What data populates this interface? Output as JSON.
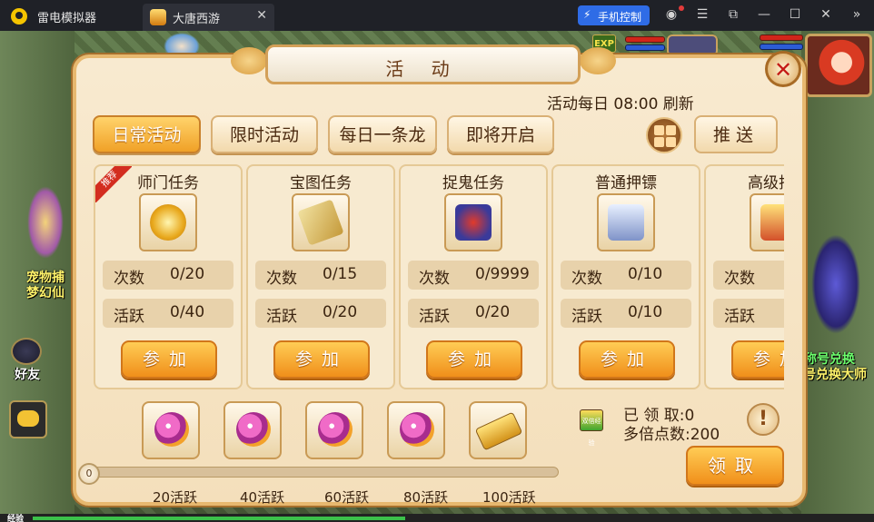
{
  "app": {
    "name": "雷电模拟器",
    "tab_title": "大唐西游",
    "tab_close": "✕",
    "phone_control": "手机控制",
    "window_buttons": {
      "account": "◉",
      "menu": "☰",
      "restore": "⧉",
      "minimize": "—",
      "maximize": "☐",
      "close": "✕",
      "more": "»"
    }
  },
  "hud": {
    "exp_badge": "EXP",
    "left_labels": [
      "宠物捕",
      "梦幻仙"
    ],
    "friend": "好友",
    "right_labels": [
      "称号兑换",
      "称号兑换大师"
    ],
    "exp_bar_label": "经验"
  },
  "dialog": {
    "title": "活 动",
    "close": "✕",
    "refresh_text": "活动每日 08:00 刷新",
    "tabs": [
      {
        "label": "日常活动",
        "active": true
      },
      {
        "label": "限时活动",
        "active": false
      },
      {
        "label": "每日一条龙",
        "active": false
      },
      {
        "label": "即将开启",
        "active": false
      }
    ],
    "push_label": "推送",
    "count_label": "次数",
    "active_label": "活跃",
    "join_label": "参加",
    "activities": [
      {
        "name": "师门任务",
        "count": "0/20",
        "active": "0/40",
        "icon": "gold-coin-icon",
        "ribbon": "推荐"
      },
      {
        "name": "宝图任务",
        "count": "0/15",
        "active": "0/20",
        "icon": "treasure-map-icon"
      },
      {
        "name": "捉鬼任务",
        "count": "0/9999",
        "active": "0/20",
        "icon": "ghost-mask-icon"
      },
      {
        "name": "普通押镖",
        "count": "0/10",
        "active": "0/10",
        "icon": "silver-chest-icon"
      },
      {
        "name": "高级押镖",
        "count": "",
        "active": "",
        "icon": "gold-chest-icon"
      }
    ],
    "rewards": {
      "progress_value": "0",
      "milestones": [
        "20活跃",
        "40活跃",
        "60活跃",
        "80活跃",
        "100活跃"
      ],
      "icons": [
        "magic-orb-icon",
        "magic-orb-icon",
        "magic-orb-icon",
        "magic-orb-icon",
        "gold-ingot-icon"
      ],
      "claimed_label": "已 领 取:",
      "claimed_value": "0",
      "multiplier_label": "多倍点数:",
      "multiplier_value": "200",
      "double_exp_icon": "双倍经验",
      "info": "!",
      "claim_button": "领取"
    }
  },
  "colors": {
    "accent": "#f0a127",
    "frame": "#e7b86f",
    "text": "#3b2410",
    "title_bar": "#1f2127",
    "phone_control": "#2f6ce6"
  }
}
